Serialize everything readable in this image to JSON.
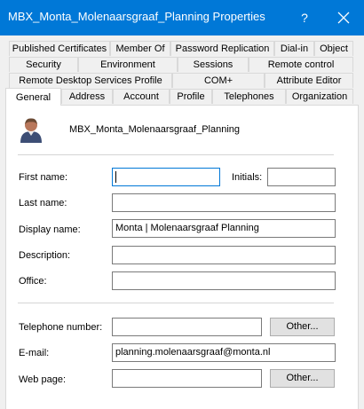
{
  "window": {
    "title": "MBX_Monta_Molenaarsgraaf_Planning Properties",
    "help_glyph": "?"
  },
  "tabs": {
    "row1": [
      "Published Certificates",
      "Member Of",
      "Password Replication",
      "Dial-in",
      "Object"
    ],
    "row2": [
      "Security",
      "Environment",
      "Sessions",
      "Remote control"
    ],
    "row3": [
      "Remote Desktop Services Profile",
      "COM+",
      "Attribute Editor"
    ],
    "row4": [
      "General",
      "Address",
      "Account",
      "Profile",
      "Telephones",
      "Organization"
    ],
    "active": "General"
  },
  "general": {
    "object_name": "MBX_Monta_Molenaarsgraaf_Planning",
    "icon": "user-icon",
    "first_name_label": "First name:",
    "first_name_value": "",
    "initials_label": "Initials:",
    "initials_value": "",
    "last_name_label": "Last name:",
    "last_name_value": "",
    "display_name_label": "Display name:",
    "display_name_value": "Monta | Molenaarsgraaf Planning",
    "description_label": "Description:",
    "description_value": "",
    "office_label": "Office:",
    "office_value": "",
    "telephone_label": "Telephone number:",
    "telephone_value": "",
    "telephone_other_button": "Other...",
    "email_label": "E-mail:",
    "email_value": "planning.molenaarsgraaf@monta.nl",
    "webpage_label": "Web page:",
    "webpage_value": "",
    "webpage_other_button": "Other..."
  },
  "colors": {
    "titlebar": "#0078d7",
    "focus_border": "#0078d7"
  }
}
